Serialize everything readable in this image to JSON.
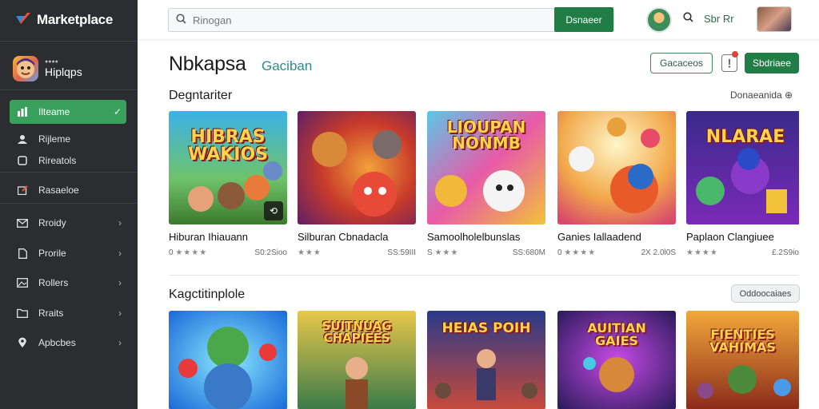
{
  "app": {
    "name": "Marketplace"
  },
  "sidebar": {
    "profile": {
      "subtitle": "●●●●",
      "name": "Hiplqps"
    },
    "items": [
      {
        "label": "Ilteame",
        "icon": "chart-icon",
        "active": true
      },
      {
        "label": "Rijleme",
        "icon": "user-icon"
      },
      {
        "label": "Rireatols",
        "icon": "document-icon"
      },
      {
        "label": "Rasaeloe",
        "icon": "edit-icon"
      },
      {
        "label": "Rroidy",
        "icon": "mail-icon"
      },
      {
        "label": "Prorile",
        "icon": "file-icon"
      },
      {
        "label": "Rollers",
        "icon": "image-icon"
      },
      {
        "label": "Rraits",
        "icon": "folder-icon"
      },
      {
        "label": "Apbcbes",
        "icon": "location-icon"
      }
    ]
  },
  "topbar": {
    "search_placeholder": "Rinogan",
    "search_button": "Dsnaeer",
    "link": "Sbr Rr"
  },
  "header": {
    "title": "Nbkapsa",
    "subtitle": "Gaciban",
    "outline_button": "Gacaceos",
    "primary_button": "Sbdriaee",
    "accent_color": "#1f7d45"
  },
  "section1": {
    "title": "Degntariter",
    "link": "Donaeanida ⊕",
    "cards": [
      {
        "title": "Hiburan Ihiauann",
        "rating": "★★★★",
        "rating_prefix": "0",
        "price": "S0:2Sioo",
        "art": "HIBRAS\nWAKIOS"
      },
      {
        "title": "Silburan Cbnadacla",
        "rating": "★★★",
        "rating_prefix": "",
        "price": "SS:59III",
        "art": ""
      },
      {
        "title": "Samoolholelbunslas",
        "rating": "★★★",
        "rating_prefix": "S",
        "price": "SS:680M",
        "art": "LIOUPAN\nNONMB"
      },
      {
        "title": "Ganies Iallaadend",
        "rating": "★★★★",
        "rating_prefix": "0",
        "price": "2X 2.0l0S",
        "art": ""
      },
      {
        "title": "Paplaon Clangiuee",
        "rating": "★★★★",
        "rating_prefix": "",
        "price": "£.2S9io",
        "art": "NLARAE"
      }
    ]
  },
  "section2": {
    "title": "Kagctitinplole",
    "button": "Oddoocaiaes",
    "cards": [
      {
        "art": ""
      },
      {
        "art": "SUITNUAG\nCHAPIEES"
      },
      {
        "art": "HEIAS POIH"
      },
      {
        "art": "AUITIAN\nGAIES"
      },
      {
        "art": "FIENTIES\nVAHIMAS"
      }
    ]
  }
}
